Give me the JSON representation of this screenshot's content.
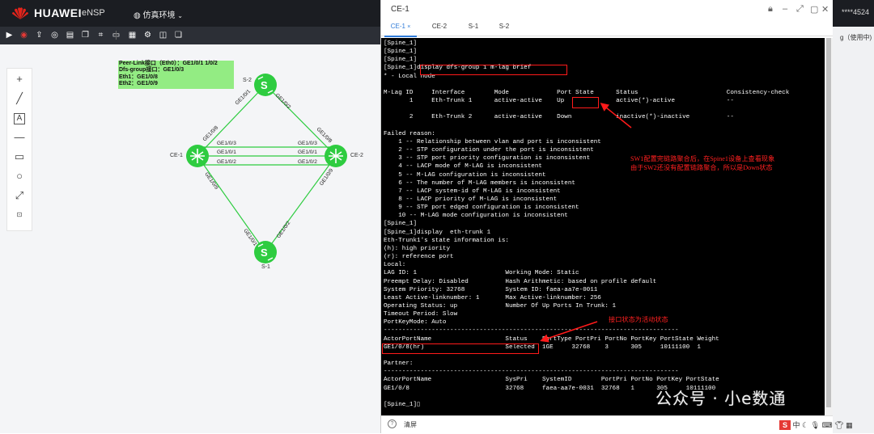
{
  "app": {
    "brand": "HUAWEI",
    "product": "eNSP",
    "env_menu": "仿真环境",
    "user_partial": "****4524",
    "usage_label": "g（使用中)"
  },
  "toolbar": {
    "icons": [
      "play-icon",
      "stop-icon",
      "upload-icon",
      "view-icon",
      "book-icon",
      "copy-icon",
      "crop-icon",
      "screen-icon",
      "grid-icon",
      "settings-icon",
      "layers-icon",
      "duplicate-icon"
    ]
  },
  "left_tools": [
    "plus-tool",
    "line-tool",
    "text-tool",
    "dash-tool",
    "rect-tool",
    "circle-tool",
    "resize-tool",
    "code-tool"
  ],
  "note": {
    "lines": [
      "Peer-Link接口（Eth0）：GE1/0/1 1/0/2",
      "Dfs-group接口：GE1/0/3",
      "Eth1：GE1/0/8",
      "Eth2：GE1/0/9"
    ]
  },
  "topology": {
    "devices": {
      "ce1": "CE-1",
      "ce2": "CE-2",
      "s1": "S-1",
      "s2": "S-2"
    },
    "ports": {
      "ce1_s2": "GE1/0/8",
      "s2_ce1": "GE1/0/1",
      "s2_ce2": "GE1/0/2",
      "ce2_s2": "GE1/0/8",
      "ce1_s1": "GE1/0/9",
      "s1_ce1": "GE1/0/1",
      "s1_ce2": "GE1/0/2",
      "ce2_s1": "GE1/0/9",
      "l1a": "GE1/0/3",
      "l1b": "GE1/0/3",
      "l2a": "GE1/0/1",
      "l2b": "GE1/0/1",
      "l3a": "GE1/0/2",
      "l3b": "GE1/0/2"
    }
  },
  "window": {
    "title": "CE-1",
    "tabs": [
      "CE-1",
      "CE-2",
      "S-1",
      "S-2"
    ],
    "active_tab": "CE-1",
    "clear_label": "清屏",
    "help_label": "?"
  },
  "terminal": {
    "lines": [
      "[Spine_1]",
      "[Spine_1]",
      "[Spine_1]",
      "[Spine_1]display dfs-group 1 m-lag brief",
      "* - Local node",
      "",
      "M-Lag ID     Interface        Mode             Port State      Status                        Consistency-check",
      "       1     Eth-Trunk 1      active-active    Up              active(*)-active              --",
      "",
      "       2     Eth-Trunk 2      active-active    Down            inactive(*)-inactive          --",
      "",
      "Failed reason:",
      "    1 -- Relationship between vlan and port is inconsistent",
      "    2 -- STP configuration under the port is inconsistent",
      "    3 -- STP port priority configuration is inconsistent",
      "    4 -- LACP mode of M-LAG is inconsistent",
      "    5 -- M-LAG configuration is inconsistent",
      "    6 -- The number of M-LAG members is inconsistent",
      "    7 -- LACP system-id of M-LAG is inconsistent",
      "    8 -- LACP priority of M-LAG is inconsistent",
      "    9 -- STP port edged configuration is inconsistent",
      "    10 -- M-LAG mode configuration is inconsistent",
      "[Spine_1]",
      "[Spine_1]display  eth-trunk 1",
      "Eth-Trunk1's state information is:",
      "(h): high priority",
      "(r): reference port",
      "Local:",
      "LAG ID: 1                        Working Mode: Static",
      "Preempt Delay: Disabled          Hash Arithmetic: based on profile default",
      "System Priority: 32768           System ID: faea-aa7e-0011",
      "Least Active-linknumber: 1       Max Active-linknumber: 256",
      "Operating Status: up             Number Of Up Ports In Trunk: 1",
      "Timeout Period: Slow",
      "PortKeyMode: Auto",
      "--------------------------------------------------------------------------------",
      "ActorPortName                    Status    PortType PortPri PortNo PortKey PortState Weight",
      "GE1/0/8(hr)                      Selected  1GE     32768    3      305     10111100  1",
      "",
      "Partner:",
      "--------------------------------------------------------------------------------",
      "ActorPortName                    SysPri    SystemID        PortPri PortNo PortKey PortState",
      "GE1/0/8                          32768     faea-aa7e-0031  32768   1      305     10111100",
      "",
      "[Spine_1]▯"
    ]
  },
  "annotations": {
    "a1_line1": "SW1配置完链路聚合后，在Spine1设备上查看现象",
    "a1_line2": "由于SW2还没有配置链路聚合，所以是Down状态",
    "a2": "接口状态为活动状态"
  },
  "watermark": "公众号 · 小e数通",
  "tray": {
    "s_label": "S",
    "ime": "中"
  }
}
